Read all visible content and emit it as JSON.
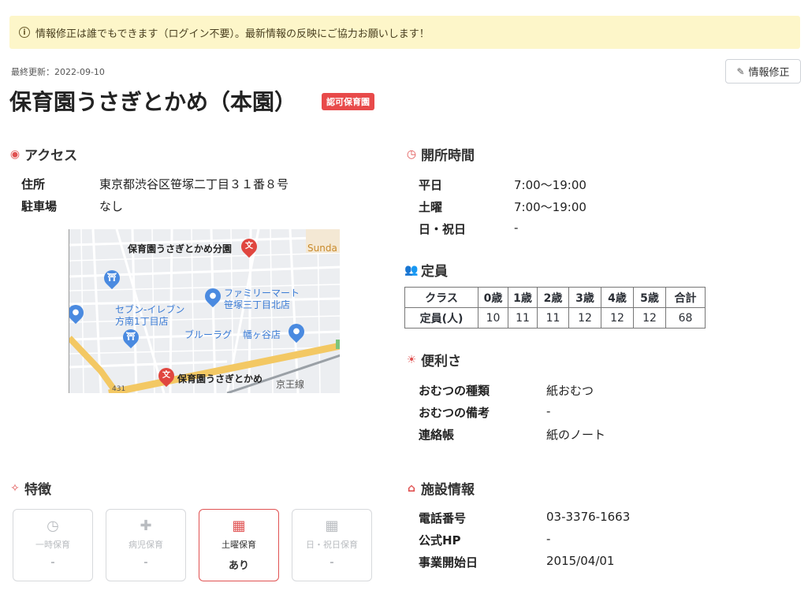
{
  "notice": {
    "text": "情報修正は誰でもできます（ログイン不要）。最新情報の反映にご協力お願いします！"
  },
  "header": {
    "updated": "最終更新：2022-09-10",
    "edit_label": "情報修正",
    "title": "保育園うさぎとかめ（本園）",
    "badge": "認可保育園"
  },
  "access": {
    "heading": "アクセス",
    "rows": [
      {
        "label": "住所",
        "value": "東京都渋谷区笹塚二丁目３１番８号"
      },
      {
        "label": "駐車場",
        "value": "なし"
      }
    ],
    "map_labels": {
      "branch": "保育園うさぎとかめ分園",
      "sunda": "Sunda",
      "family_mart": "ファミリーマート",
      "family_mart_2": "笹塚三丁目北店",
      "seven": "セブン-イレブン",
      "seven_2": "方南1丁目店",
      "blue_rug": "ブルーラグ",
      "hatagaya": "幡ヶ谷店",
      "main": "保育園うさぎとかめ",
      "keio": "京王線",
      "route": "431"
    }
  },
  "hours": {
    "heading": "開所時間",
    "rows": [
      {
        "label": "平日",
        "value": "7:00〜19:00"
      },
      {
        "label": "土曜",
        "value": "7:00〜19:00"
      },
      {
        "label": "日・祝日",
        "value": "-"
      }
    ]
  },
  "capacity": {
    "heading": "定員",
    "headers": [
      "クラス",
      "0歳",
      "1歳",
      "2歳",
      "3歳",
      "4歳",
      "5歳",
      "合計"
    ],
    "row_label": "定員(人)",
    "values": [
      "10",
      "11",
      "11",
      "12",
      "12",
      "12",
      "68"
    ]
  },
  "convenience": {
    "heading": "便利さ",
    "rows": [
      {
        "label": "おむつの種類",
        "value": "紙おむつ"
      },
      {
        "label": "おむつの備考",
        "value": "-"
      },
      {
        "label": "連絡帳",
        "value": "紙のノート"
      }
    ]
  },
  "features": {
    "heading": "特徴",
    "items": [
      {
        "name": "一時保育",
        "value": "-",
        "icon": "clock-icon",
        "active": false
      },
      {
        "name": "病児保育",
        "value": "-",
        "icon": "medical-hand-icon",
        "active": false
      },
      {
        "name": "土曜保育",
        "value": "あり",
        "icon": "calendar-icon",
        "active": true
      },
      {
        "name": "日・祝日保育",
        "value": "-",
        "icon": "calendar-icon",
        "active": false
      }
    ]
  },
  "facility": {
    "heading": "施設情報",
    "rows": [
      {
        "label": "電話番号",
        "value": "03-3376-1663"
      },
      {
        "label": "公式HP",
        "value": "-"
      },
      {
        "label": "事業開始日",
        "value": "2015/04/01"
      }
    ]
  },
  "colors": {
    "accent": "#e05252",
    "notice_bg": "#fdf6c9",
    "badge_bg": "#e84a4a",
    "map_blue": "#3a7bd5"
  }
}
